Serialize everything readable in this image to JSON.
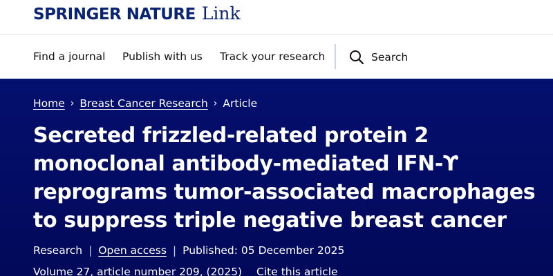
{
  "header": {
    "brand": "SPRINGER NATURE",
    "brand_suffix": "Link"
  },
  "nav": {
    "items": [
      {
        "label": "Find a journal"
      },
      {
        "label": "Publish with us"
      },
      {
        "label": "Track your research"
      }
    ],
    "search_label": "Search"
  },
  "breadcrumb": {
    "items": [
      "Home",
      "Breast Cancer Research",
      "Article"
    ],
    "separator": "›"
  },
  "article": {
    "title": "Secreted frizzled-related protein 2 monoclonal antibody-mediated IFN-ϒ reprograms tumor-associated macrophages to suppress triple negative breast cancer",
    "type": "Research",
    "access": "Open access",
    "published": "Published: 05 December 2025",
    "citation": "Volume 27, article number 209, (2025)",
    "cite_label": "Cite this article"
  },
  "colors": {
    "brand_navy": "#0a2473",
    "hero_background": "#04106e",
    "divider": "#c7d4ee"
  },
  "icons": {
    "search": "search-icon",
    "breadcrumb_separator": "chevron-right-icon"
  }
}
